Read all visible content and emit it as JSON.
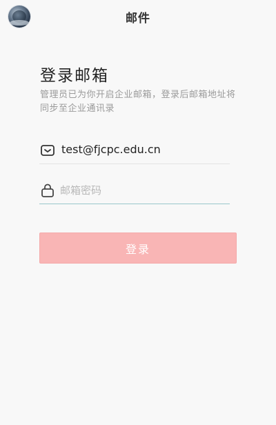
{
  "header": {
    "title": "邮件",
    "avatar_icon": "user-avatar-icon"
  },
  "login": {
    "title": "登录邮箱",
    "subtitle": "管理员已为你开启企业邮箱，登录后邮箱地址将同步至企业通讯录",
    "email": {
      "icon": "mail-icon",
      "value": "test@fjcpc.edu.cn"
    },
    "password": {
      "icon": "lock-icon",
      "placeholder": "邮箱密码",
      "value": ""
    },
    "submit_label": "登录"
  },
  "colors": {
    "background": "#f8f8f8",
    "button": "#f9b5b5",
    "focus_underline": "#98c7cb",
    "subtitle_text": "#9a9a9a"
  }
}
